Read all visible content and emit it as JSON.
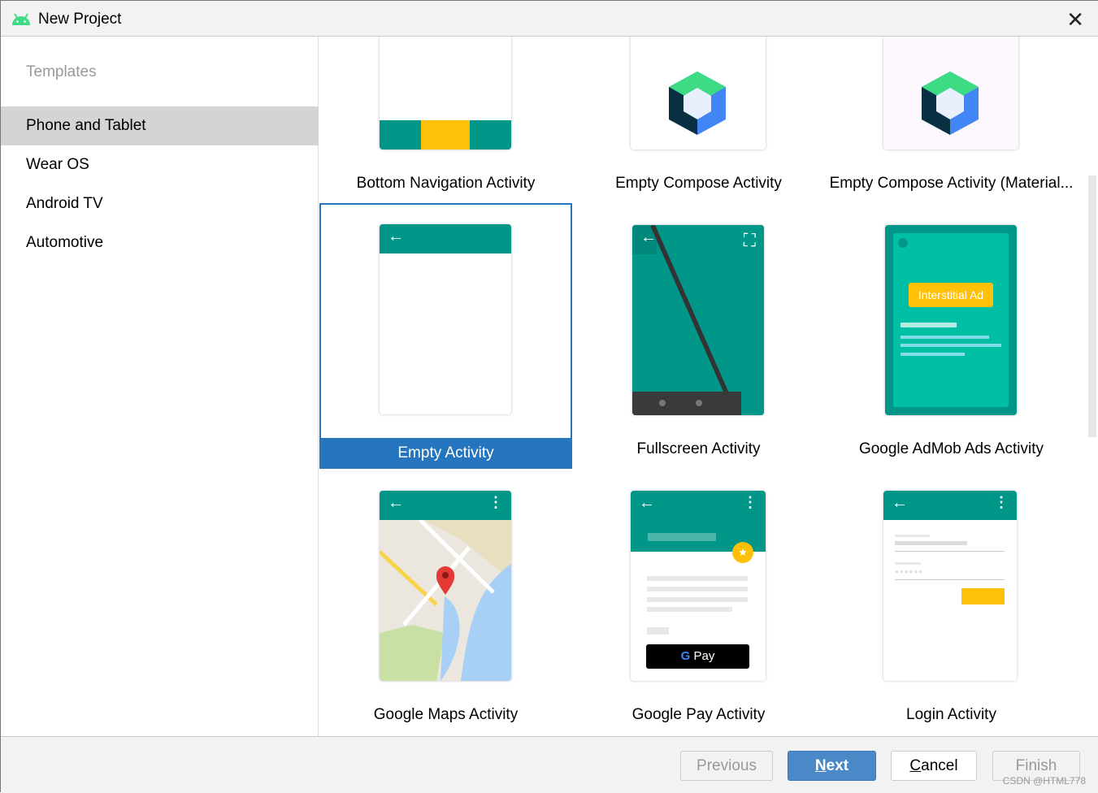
{
  "window": {
    "title": "New Project",
    "close_icon": "close-icon",
    "logo": "android-icon"
  },
  "sidebar": {
    "header": "Templates",
    "items": [
      {
        "label": "Phone and Tablet",
        "selected": true
      },
      {
        "label": "Wear OS"
      },
      {
        "label": "Android TV"
      },
      {
        "label": "Automotive"
      }
    ]
  },
  "templates": [
    {
      "label": "Bottom Navigation Activity"
    },
    {
      "label": "Empty Compose Activity"
    },
    {
      "label": "Empty Compose Activity (Material..."
    },
    {
      "label": "Empty Activity",
      "selected": true
    },
    {
      "label": "Fullscreen Activity"
    },
    {
      "label": "Google AdMob Ads Activity",
      "ad_text": "Interstitial Ad"
    },
    {
      "label": "Google Maps Activity"
    },
    {
      "label": "Google Pay Activity",
      "pay_text": "Pay",
      "g": "G"
    },
    {
      "label": "Login Activity"
    }
  ],
  "footer": {
    "previous": "Previous",
    "next_mn": "N",
    "next_rest": "ext",
    "cancel_mn": "C",
    "cancel_rest": "ancel",
    "finish": "Finish",
    "watermark": "CSDN @HTML778"
  },
  "colors": {
    "accent": "#2675bf",
    "teal": "#009688",
    "amber": "#ffc107"
  }
}
